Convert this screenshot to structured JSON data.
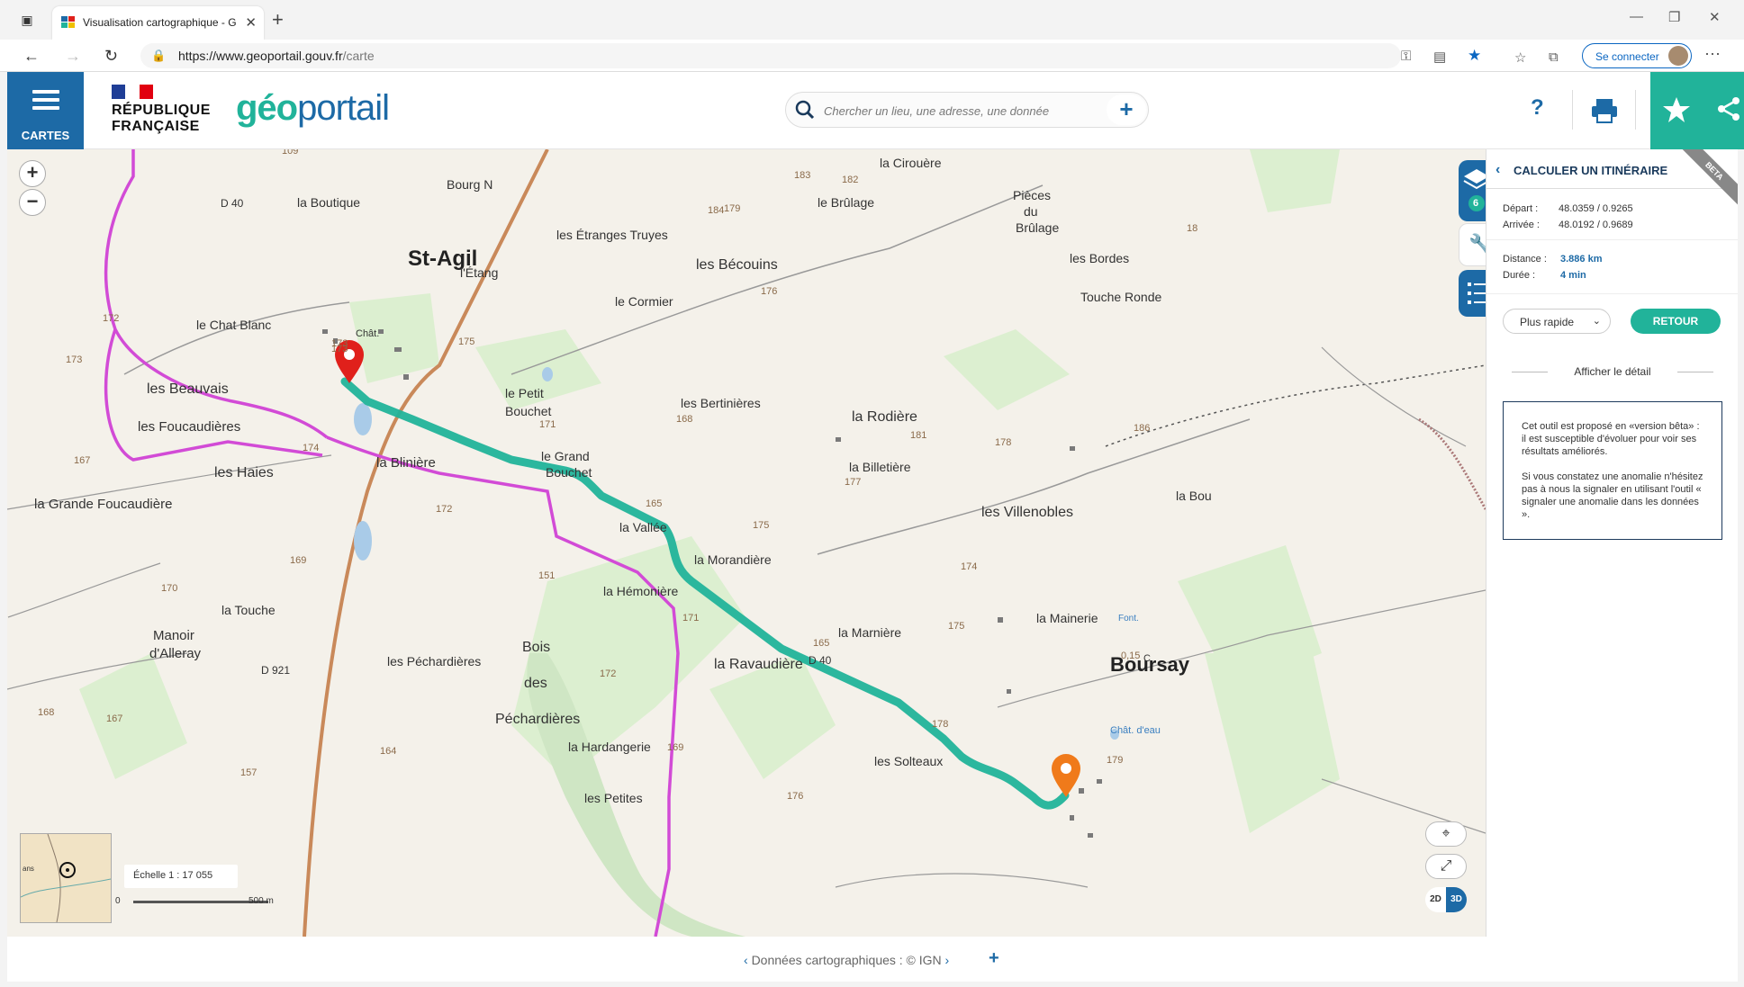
{
  "browser": {
    "tab_title": "Visualisation cartographique - G",
    "url_host": "https://www.geoportail.gouv.fr",
    "url_path": "/carte",
    "signin_label": "Se connecter"
  },
  "header": {
    "menu_label": "CARTES",
    "rf_line1": "RÉPUBLIQUE",
    "rf_line2": "FRANÇAISE",
    "logo_part1": "géo",
    "logo_part2": "portail",
    "search_placeholder": "Chercher un lieu, une adresse, une donnée",
    "help_label": "?"
  },
  "map": {
    "layers_count": "6",
    "scale_label": "Échelle 1 : 17 055",
    "scale_start": "0",
    "scale_end": "500 m",
    "dim_2d": "2D",
    "dim_3d": "3D",
    "minimap_label": "ans",
    "places": [
      {
        "t": "St-Agil",
        "cls": "big"
      },
      {
        "t": "Boursay",
        "cls": "big"
      },
      {
        "t": "la Boutique"
      },
      {
        "t": "les Étranges Truyes"
      },
      {
        "t": "l'Étang"
      },
      {
        "t": "les Bécouins"
      },
      {
        "t": "le Brûlage"
      },
      {
        "t": "Pièces"
      },
      {
        "t": "du"
      },
      {
        "t": "Brûlage"
      },
      {
        "t": "les Bordes"
      },
      {
        "t": "Touche Ronde"
      },
      {
        "t": "le Chat Blanc"
      },
      {
        "t": "les Beauvais"
      },
      {
        "t": "les Foucaudières"
      },
      {
        "t": "les Haies"
      },
      {
        "t": "la Grande Foucaudière"
      },
      {
        "t": "la Blinière"
      },
      {
        "t": "le Petit"
      },
      {
        "t": "Bouchet"
      },
      {
        "t": "le Grand"
      },
      {
        "t": "Bouchet"
      },
      {
        "t": "les Bertinières"
      },
      {
        "t": "la Rodière"
      },
      {
        "t": "la Billetière"
      },
      {
        "t": "les Villenobles"
      },
      {
        "t": "la Vallée"
      },
      {
        "t": "la Morandière"
      },
      {
        "t": "la Hémonière"
      },
      {
        "t": "la Touche"
      },
      {
        "t": "Manoir"
      },
      {
        "t": "d'Alleray"
      },
      {
        "t": "les Péchardières"
      },
      {
        "t": "Bois"
      },
      {
        "t": "des"
      },
      {
        "t": "Péchardières"
      },
      {
        "t": "la Hardangerie"
      },
      {
        "t": "la Marnière"
      },
      {
        "t": "la Ravaudière"
      },
      {
        "t": "la Mainerie"
      },
      {
        "t": "les Solteaux"
      },
      {
        "t": "les Petites"
      },
      {
        "t": "la Cirouère"
      },
      {
        "t": "Bourg N"
      },
      {
        "t": "le Cormier"
      },
      {
        "t": "Chât."
      },
      {
        "t": "Chât. d'eau"
      },
      {
        "t": "Font."
      },
      {
        "t": "la Bou"
      },
      {
        "t": "D 40"
      },
      {
        "t": "D 40"
      },
      {
        "t": "D 921"
      },
      {
        "t": "173"
      },
      {
        "t": "172"
      },
      {
        "t": "173"
      },
      {
        "t": "174"
      },
      {
        "t": "175"
      },
      {
        "t": "171"
      },
      {
        "t": "168"
      },
      {
        "t": "181"
      },
      {
        "t": "178"
      },
      {
        "t": "186"
      },
      {
        "t": "177"
      },
      {
        "t": "176"
      },
      {
        "t": "184"
      },
      {
        "t": "183"
      },
      {
        "t": "182"
      },
      {
        "t": "179"
      },
      {
        "t": "172"
      },
      {
        "t": "169"
      },
      {
        "t": "170"
      },
      {
        "t": "167"
      },
      {
        "t": "168"
      },
      {
        "t": "167"
      },
      {
        "t": "165"
      },
      {
        "t": "151"
      },
      {
        "t": "172"
      },
      {
        "t": "171"
      },
      {
        "t": "164"
      },
      {
        "t": "157"
      },
      {
        "t": "169"
      },
      {
        "t": "175"
      },
      {
        "t": "174"
      },
      {
        "t": "165"
      },
      {
        "t": "178"
      },
      {
        "t": "179"
      },
      {
        "t": "176"
      },
      {
        "t": "175"
      },
      {
        "t": "0,15"
      },
      {
        "t": "C"
      },
      {
        "t": "18"
      },
      {
        "t": "109"
      },
      {
        "t": "173"
      }
    ]
  },
  "panel": {
    "title": "CALCULER UN ITINÉRAIRE",
    "beta": "BETA",
    "depart_label": "Départ :",
    "depart_value": "48.0359 / 0.9265",
    "arrivee_label": "Arrivée :",
    "arrivee_value": "48.0192 / 0.9689",
    "distance_label": "Distance :",
    "distance_value": "3.886 km",
    "duree_label": "Durée :",
    "duree_value": "4 min",
    "mode_label": "Plus rapide",
    "retour_label": "RETOUR",
    "detail_label": "Afficher le détail",
    "info_p1": "Cet outil est proposé en «version bêta» : il est susceptible d'évoluer pour voir ses résultats améliorés.",
    "info_p2": "Si vous constatez une anomalie n'hésitez pas à nous la signaler en utilisant l'outil « signaler une anomalie dans les données »."
  },
  "footer": {
    "attribution": "Données cartographiques : © IGN",
    "prev": "‹",
    "next": "›",
    "plus": "+"
  },
  "colors": {
    "brand_blue": "#1d6aa6",
    "route_green": "#21b39a",
    "alt_route": "#d24bd6",
    "start_pin": "#e0201b",
    "end_pin": "#f07a1a"
  }
}
